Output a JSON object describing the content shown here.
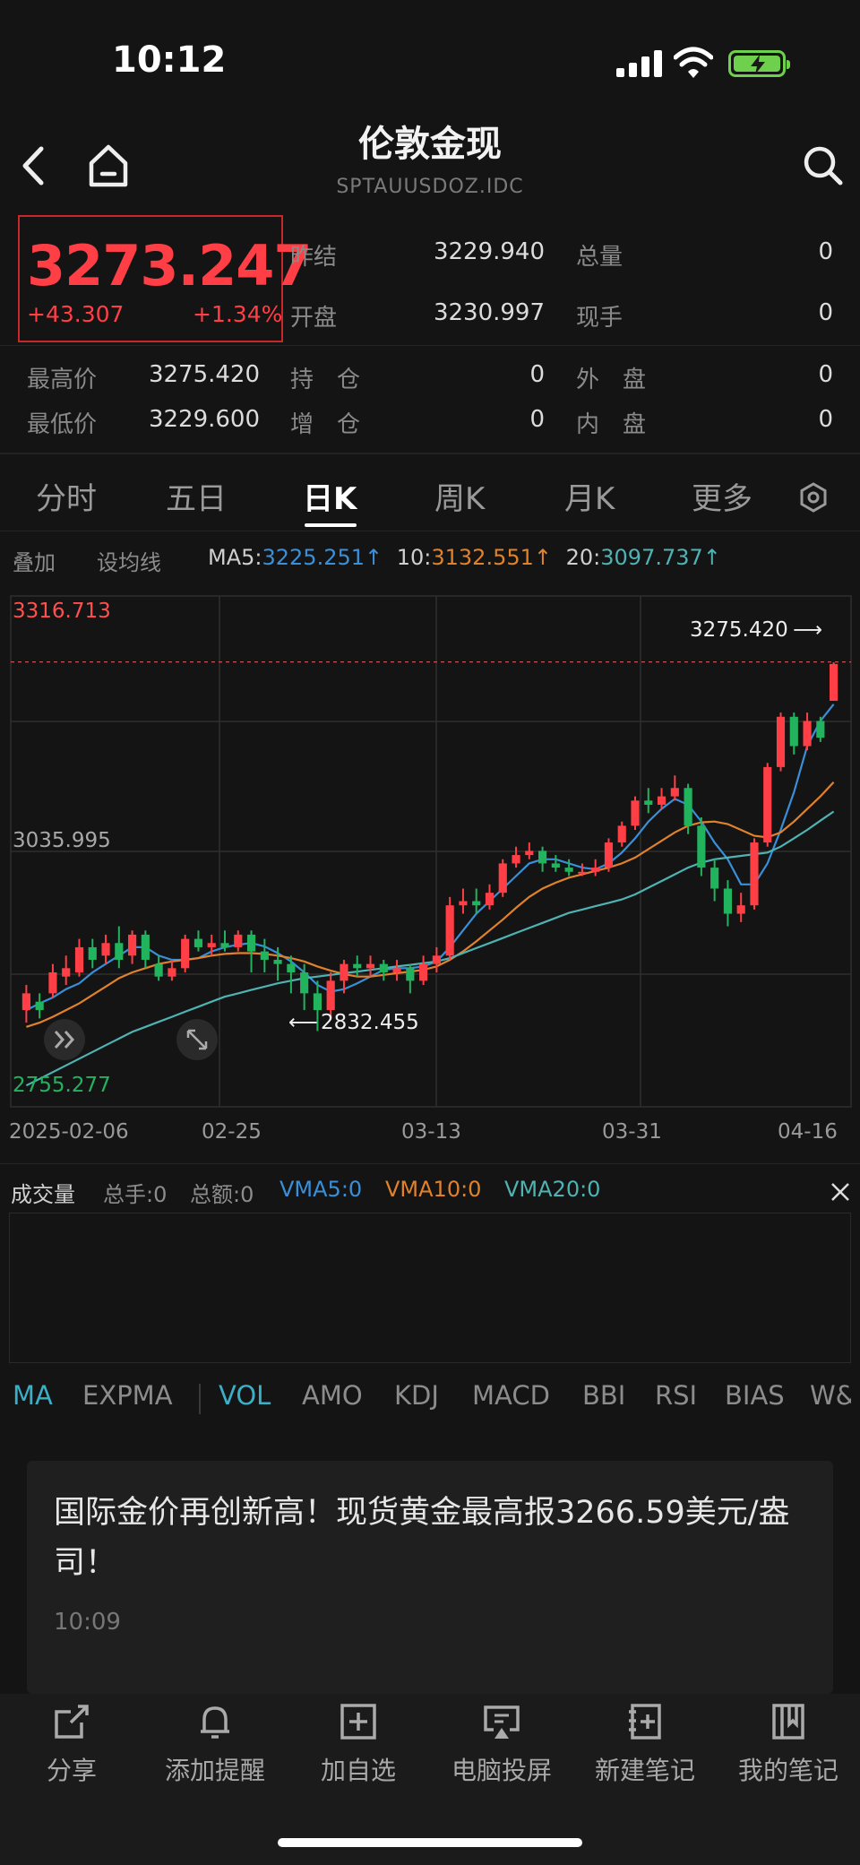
{
  "status": {
    "time": "10:12"
  },
  "header": {
    "title": "伦敦金现",
    "subtitle": "SPTAUUSDOZ.IDC"
  },
  "quote": {
    "price": "3273.247",
    "change": "+43.307",
    "change_pct": "+1.34%",
    "fields": {
      "prev_close_label": "昨结",
      "prev_close": "3229.940",
      "total_vol_label": "总量",
      "total_vol": "0",
      "open_label": "开盘",
      "open": "3230.997",
      "cur_vol_label": "现手",
      "cur_vol": "0",
      "high_label": "最高价",
      "high": "3275.420",
      "hold_label": "持　仓",
      "hold": "0",
      "outer_label": "外　盘",
      "outer": "0",
      "low_label": "最低价",
      "low": "3229.600",
      "add_label": "增　仓",
      "add": "0",
      "inner_label": "内　盘",
      "inner": "0"
    }
  },
  "tabs": [
    "分时",
    "五日",
    "日K",
    "周K",
    "月K",
    "更多"
  ],
  "ma_bar": {
    "overlay": "叠加",
    "set_ma": "设均线",
    "ma5_label": "MA5:",
    "ma5": "3225.251↑",
    "ma10_label": "10:",
    "ma10": "3132.551↑",
    "ma20_label": "20:",
    "ma20": "3097.737↑"
  },
  "chart_data": {
    "type": "candlestick",
    "y_labels": {
      "top": "3316.713",
      "mid": "3035.995",
      "bottom": "2755.277"
    },
    "ylim": [
      2755.277,
      3316.713
    ],
    "x_labels": [
      "2025-02-06",
      "02-25",
      "03-13",
      "03-31",
      "04-16"
    ],
    "max_marker": "3275.420",
    "min_marker": "2832.455",
    "candles": [
      [
        2860,
        2880,
        2845,
        2890
      ],
      [
        2870,
        2860,
        2850,
        2880
      ],
      [
        2880,
        2905,
        2875,
        2915
      ],
      [
        2900,
        2910,
        2890,
        2925
      ],
      [
        2905,
        2935,
        2900,
        2945
      ],
      [
        2935,
        2920,
        2910,
        2945
      ],
      [
        2925,
        2940,
        2915,
        2950
      ],
      [
        2940,
        2920,
        2910,
        2960
      ],
      [
        2925,
        2950,
        2915,
        2955
      ],
      [
        2950,
        2920,
        2910,
        2955
      ],
      [
        2915,
        2900,
        2895,
        2925
      ],
      [
        2900,
        2910,
        2895,
        2920
      ],
      [
        2910,
        2945,
        2905,
        2950
      ],
      [
        2945,
        2935,
        2930,
        2955
      ],
      [
        2935,
        2940,
        2925,
        2950
      ],
      [
        2940,
        2935,
        2930,
        2955
      ],
      [
        2935,
        2950,
        2930,
        2955
      ],
      [
        2950,
        2930,
        2905,
        2955
      ],
      [
        2930,
        2920,
        2905,
        2945
      ],
      [
        2920,
        2915,
        2895,
        2935
      ],
      [
        2915,
        2905,
        2880,
        2925
      ],
      [
        2905,
        2880,
        2860,
        2915
      ],
      [
        2880,
        2860,
        2835,
        2895
      ],
      [
        2860,
        2895,
        2850,
        2905
      ],
      [
        2895,
        2915,
        2880,
        2920
      ],
      [
        2915,
        2910,
        2900,
        2925
      ],
      [
        2910,
        2915,
        2900,
        2925
      ],
      [
        2915,
        2905,
        2895,
        2920
      ],
      [
        2905,
        2910,
        2895,
        2920
      ],
      [
        2910,
        2895,
        2880,
        2915
      ],
      [
        2895,
        2915,
        2890,
        2925
      ],
      [
        2915,
        2925,
        2905,
        2935
      ],
      [
        2925,
        2985,
        2920,
        2995
      ],
      [
        2985,
        2990,
        2975,
        3005
      ],
      [
        2990,
        2985,
        2975,
        3005
      ],
      [
        2985,
        3000,
        2980,
        3010
      ],
      [
        3000,
        3035,
        2995,
        3040
      ],
      [
        3035,
        3045,
        3030,
        3055
      ],
      [
        3045,
        3050,
        3040,
        3060
      ],
      [
        3050,
        3035,
        3025,
        3055
      ],
      [
        3035,
        3030,
        3025,
        3045
      ],
      [
        3030,
        3025,
        3020,
        3040
      ],
      [
        3025,
        3025,
        3020,
        3035
      ],
      [
        3025,
        3030,
        3020,
        3040
      ],
      [
        3030,
        3060,
        3025,
        3065
      ],
      [
        3060,
        3080,
        3055,
        3085
      ],
      [
        3080,
        3110,
        3075,
        3115
      ],
      [
        3110,
        3105,
        3095,
        3125
      ],
      [
        3105,
        3115,
        3100,
        3125
      ],
      [
        3115,
        3125,
        3110,
        3140
      ],
      [
        3125,
        3080,
        3070,
        3130
      ],
      [
        3080,
        3030,
        3020,
        3090
      ],
      [
        3030,
        3005,
        2990,
        3040
      ],
      [
        3005,
        2975,
        2960,
        3015
      ],
      [
        2975,
        2985,
        2965,
        3000
      ],
      [
        2985,
        3060,
        2980,
        3065
      ],
      [
        3060,
        3150,
        3055,
        3155
      ],
      [
        3150,
        3210,
        3145,
        3215
      ],
      [
        3210,
        3175,
        3165,
        3215
      ],
      [
        3175,
        3205,
        3170,
        3215
      ],
      [
        3205,
        3185,
        3180,
        3210
      ],
      [
        3229,
        3273,
        3229,
        3275
      ]
    ],
    "ma5": [
      2860,
      2868,
      2875,
      2885,
      2892,
      2905,
      2915,
      2925,
      2935,
      2935,
      2925,
      2920,
      2920,
      2922,
      2930,
      2935,
      2938,
      2940,
      2936,
      2928,
      2918,
      2905,
      2890,
      2882,
      2885,
      2892,
      2900,
      2908,
      2910,
      2910,
      2912,
      2918,
      2935,
      2955,
      2975,
      2990,
      3005,
      3020,
      3035,
      3040,
      3040,
      3035,
      3030,
      3028,
      3035,
      3048,
      3065,
      3085,
      3100,
      3112,
      3105,
      3085,
      3060,
      3040,
      3010,
      3010,
      3035,
      3075,
      3120,
      3175,
      3205,
      3225
    ],
    "ma10": [
      2840,
      2845,
      2852,
      2860,
      2868,
      2878,
      2888,
      2898,
      2905,
      2910,
      2915,
      2918,
      2920,
      2922,
      2925,
      2927,
      2928,
      2928,
      2927,
      2925,
      2922,
      2918,
      2912,
      2907,
      2903,
      2900,
      2900,
      2902,
      2904,
      2906,
      2908,
      2912,
      2920,
      2930,
      2942,
      2955,
      2968,
      2982,
      2995,
      3005,
      3012,
      3018,
      3022,
      3026,
      3030,
      3035,
      3042,
      3052,
      3062,
      3072,
      3080,
      3084,
      3085,
      3082,
      3075,
      3068,
      3066,
      3072,
      3085,
      3100,
      3115,
      3132
    ]
  },
  "ma20": [
    2770,
    2778,
    2786,
    2794,
    2802,
    2810,
    2818,
    2826,
    2834,
    2840,
    2846,
    2852,
    2858,
    2864,
    2870,
    2876,
    2880,
    2884,
    2888,
    2892,
    2895,
    2898,
    2900,
    2902,
    2904,
    2906,
    2908,
    2910,
    2912,
    2914,
    2916,
    2918,
    2922,
    2928,
    2934,
    2940,
    2946,
    2952,
    2958,
    2964,
    2970,
    2976,
    2980,
    2984,
    2988,
    2992,
    2998,
    3006,
    3014,
    3022,
    3030,
    3036,
    3040,
    3042,
    3044,
    3046,
    3048,
    3055,
    3065,
    3075,
    3086,
    3097
  ],
  "volume": {
    "title": "成交量",
    "hands": "总手:0",
    "amount": "总额:0",
    "vma5": "VMA5:0",
    "vma10": "VMA10:0",
    "vma20": "VMA20:0"
  },
  "indicators": [
    "MA",
    "EXPMA",
    "VOL",
    "AMO",
    "KDJ",
    "MACD",
    "BBI",
    "RSI",
    "BIAS",
    "W&"
  ],
  "news": {
    "title": "国际金价再创新高！现货黄金最高报3266.59美元/盎司！",
    "time": "10:09"
  },
  "bottom_bar": [
    "分享",
    "添加提醒",
    "加自选",
    "电脑投屏",
    "新建笔记",
    "我的笔记"
  ],
  "colors": {
    "up": "#ff3f45",
    "down": "#22b35e",
    "ma5": "#3a8fd9",
    "ma10": "#e0822c",
    "ma20": "#4fb3b3"
  }
}
